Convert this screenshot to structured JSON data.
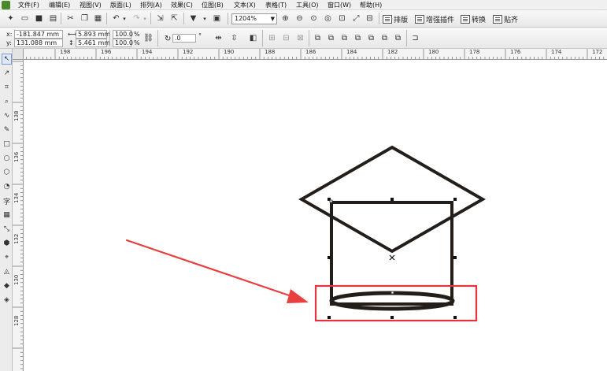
{
  "menubar": {
    "items": [
      "文件(F)",
      "编辑(E)",
      "视图(V)",
      "版面(L)",
      "排列(A)",
      "效果(C)",
      "位图(B)",
      "文本(X)",
      "表格(T)",
      "工具(O)",
      "窗口(W)",
      "帮助(H)"
    ]
  },
  "toolbar": {
    "zoom": "1204%",
    "plugins": {
      "layout": "排版",
      "enhance": "增强插件",
      "convert": "转换",
      "paste": "贴齐"
    }
  },
  "property_bar": {
    "x": "-181.847 mm",
    "y": "131.088 mm",
    "width": "5.893 mm",
    "height": "5.461 mm",
    "scale_x": "100.0",
    "scale_y": "100.0",
    "scale_unit": "%",
    "rotation": ".0",
    "rotation_unit": "°",
    "x_label": "x:",
    "y_label": "y:"
  },
  "rulers": {
    "top_labels": [
      "198",
      "196",
      "194",
      "192",
      "190",
      "188",
      "186",
      "184",
      "182",
      "180",
      "178",
      "176",
      "174",
      "172"
    ],
    "left_labels": [
      "138",
      "136",
      "134",
      "132",
      "130",
      "128"
    ]
  },
  "colors": {
    "shape_stroke": "#231e1a",
    "highlight_box": "#e8323c",
    "arrow": "#e84040"
  },
  "toolbox": {
    "tools": [
      "pick-tool",
      "shape-tool",
      "crop-tool",
      "zoom-tool",
      "freehand-tool",
      "smart-fill-tool",
      "rectangle-tool",
      "ellipse-tool",
      "polygon-tool",
      "basic-shapes-tool",
      "text-tool",
      "table-tool",
      "dimension-tool",
      "connector-tool",
      "interactive-tool",
      "eyedropper-tool",
      "outline-tool",
      "fill-tool",
      "interactive-fill-tool"
    ]
  }
}
